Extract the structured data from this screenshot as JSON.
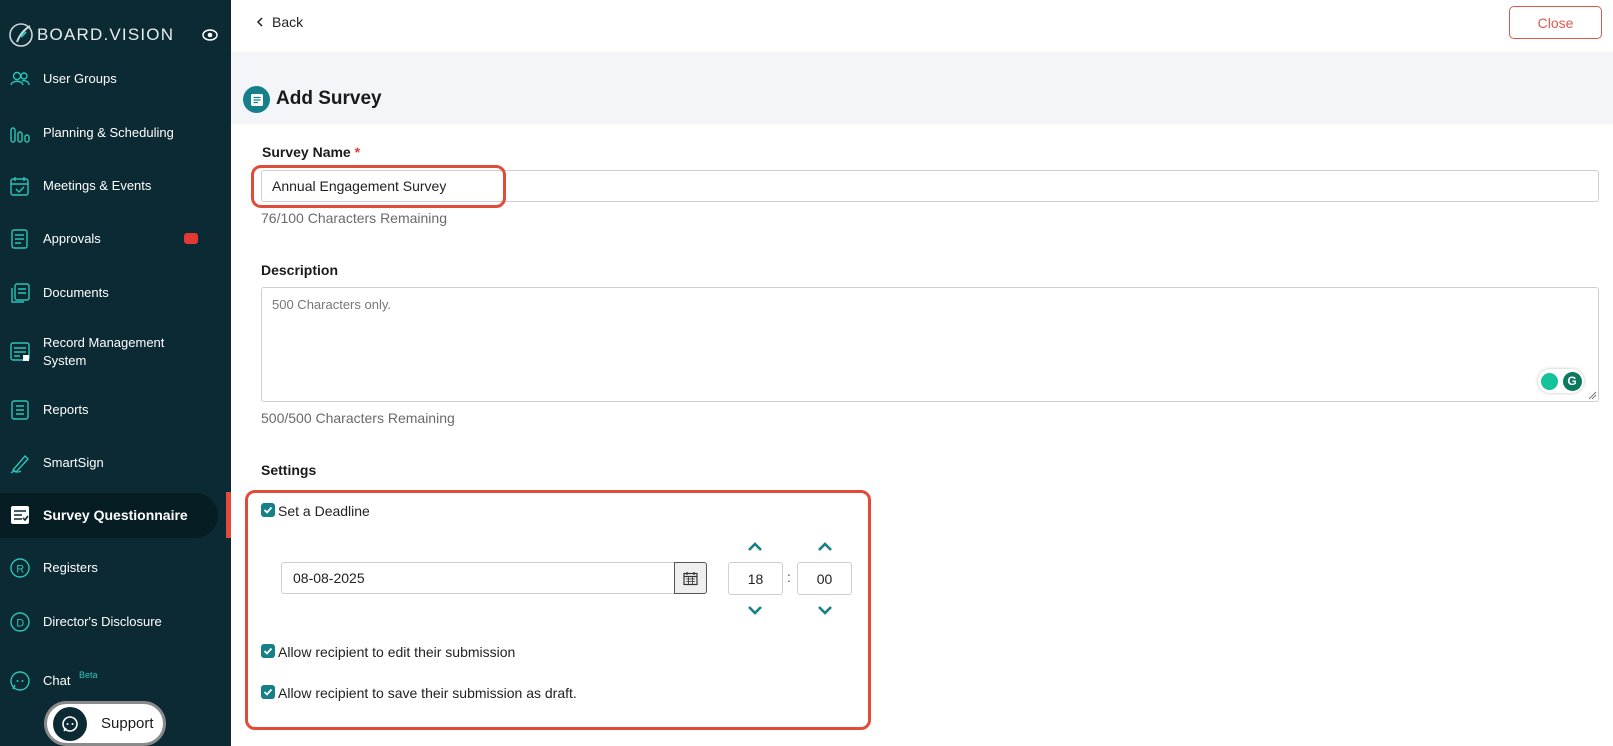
{
  "app": {
    "brand": "BOARD.VISION"
  },
  "sidebar": {
    "items": [
      {
        "label": "User Groups",
        "icon": "users-icon"
      },
      {
        "label": "Planning & Scheduling",
        "icon": "bar-chart-icon"
      },
      {
        "label": "Meetings & Events",
        "icon": "calendar-check-icon"
      },
      {
        "label": "Approvals",
        "icon": "approval-document-icon"
      },
      {
        "label": "Documents",
        "icon": "documents-icon"
      },
      {
        "label": "Record Management System",
        "icon": "record-management-icon"
      },
      {
        "label": "Reports",
        "icon": "reports-icon"
      },
      {
        "label": "SmartSign",
        "icon": "signature-pen-icon"
      },
      {
        "label": "Survey Questionnaire",
        "icon": "survey-icon",
        "active": true
      },
      {
        "label": "Registers",
        "icon": "registered-r-icon"
      },
      {
        "label": "Director's Disclosure",
        "icon": "disclosure-d-icon"
      },
      {
        "label": "Chat",
        "icon": "chat-icon"
      }
    ],
    "chat_badge": "Beta",
    "support_label": "Support"
  },
  "topbar": {
    "back_label": "Back",
    "close_label": "Close"
  },
  "page": {
    "title": "Add Survey"
  },
  "form": {
    "survey_name_label": "Survey Name",
    "required_mark": "*",
    "survey_name_value": "Annual Engagement Survey",
    "survey_name_hint": "76/100 Characters Remaining",
    "description_label": "Description",
    "description_placeholder": "500 Characters only.",
    "description_hint": "500/500 Characters Remaining",
    "settings_label": "Settings",
    "deadline_checkbox_label": "Set a Deadline",
    "deadline_checked": true,
    "deadline_date": "08-08-2025",
    "deadline_hour": "18",
    "deadline_minute": "00",
    "time_separator": ":",
    "edit_checkbox_label": "Allow recipient to edit their submission",
    "edit_checked": true,
    "draft_checkbox_label": "Allow recipient to save their submission as draft.",
    "draft_checked": true
  },
  "colors": {
    "sidebar_bg": "#0c2a33",
    "accent": "#16808a",
    "highlight": "#e04b3a",
    "close_red": "#e0584b"
  }
}
